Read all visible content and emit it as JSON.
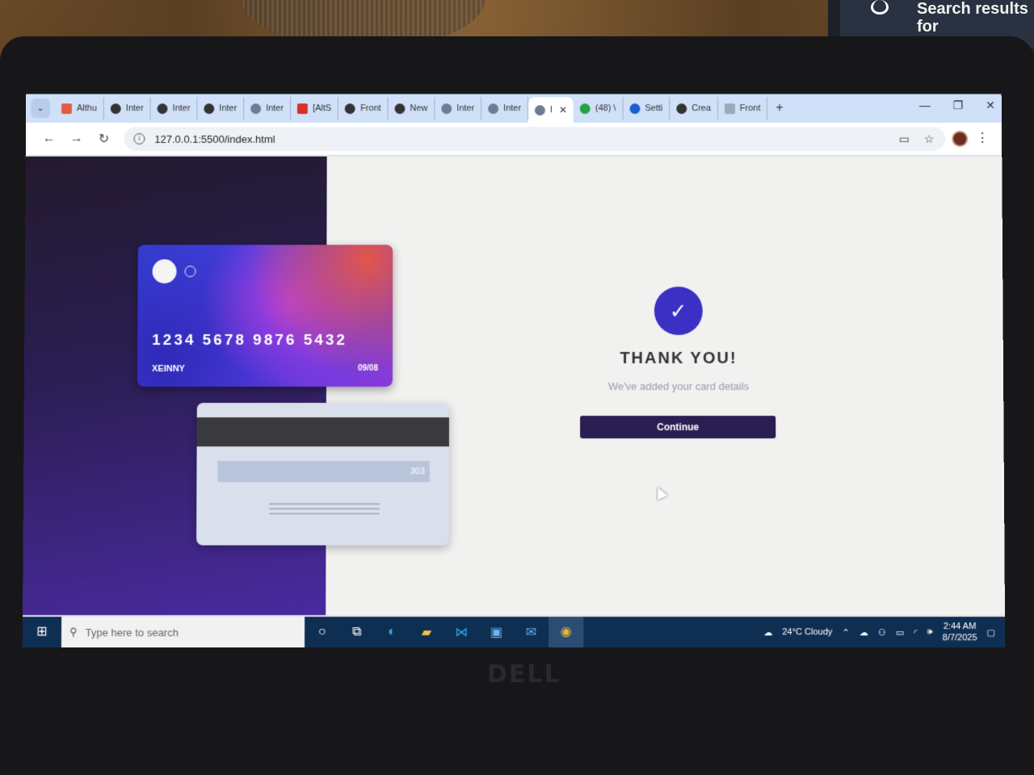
{
  "background": {
    "second_monitor_text": "Search results for"
  },
  "browser": {
    "tabs": [
      {
        "label": "Althu",
        "active": false
      },
      {
        "label": "Inter",
        "active": false
      },
      {
        "label": "Inter",
        "active": false
      },
      {
        "label": "Inter",
        "active": false
      },
      {
        "label": "Inter",
        "active": false
      },
      {
        "label": "[AltS",
        "active": false
      },
      {
        "label": "Front",
        "active": false
      },
      {
        "label": "New",
        "active": false
      },
      {
        "label": "Inter",
        "active": false
      },
      {
        "label": "Inter",
        "active": false
      },
      {
        "label": "I",
        "active": true
      },
      {
        "label": "(48) \\",
        "active": false
      },
      {
        "label": "Setti",
        "active": false
      },
      {
        "label": "Crea",
        "active": false
      },
      {
        "label": "Front",
        "active": false
      }
    ],
    "new_tab": "+",
    "window_controls": {
      "minimize": "—",
      "restore": "❐",
      "close": "✕"
    },
    "url": "127.0.0.1:5500/index.html"
  },
  "page": {
    "card_front": {
      "number": "1234 5678 9876 5432",
      "name": "XEINNY",
      "expiry": "09/08"
    },
    "card_back": {
      "cvv": "303"
    },
    "success": {
      "title": "THANK YOU!",
      "subtitle": "We've added your card details",
      "button": "Continue"
    }
  },
  "taskbar": {
    "search_placeholder": "Type here to search",
    "weather": "24°C  Cloudy",
    "time": "2:44 AM",
    "date": "8/7/2025"
  },
  "colors": {
    "accent": "#3b2fc4",
    "button": "#2b1e52",
    "taskbar": "#0f2f52"
  },
  "laptop_brand": "DELL"
}
